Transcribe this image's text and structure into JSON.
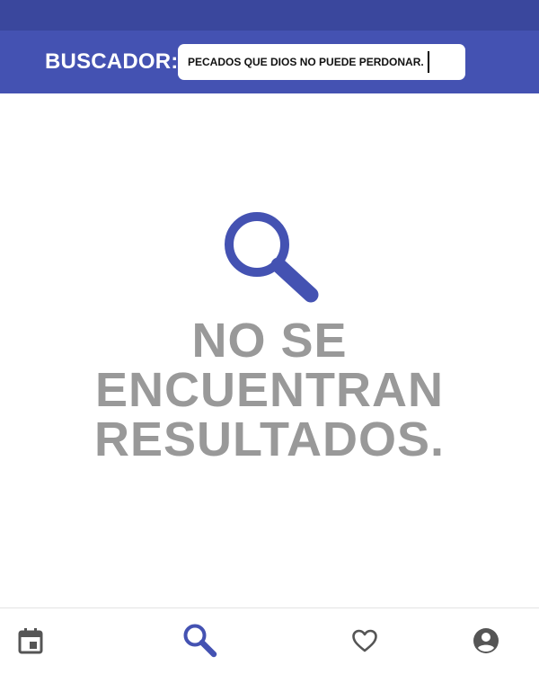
{
  "header": {
    "label": "BUSCADOR:",
    "search_value": "PECADOS QUE DIOS NO PUEDE PERDONAR."
  },
  "empty_state": {
    "icon": "search-icon",
    "message_line_1": "NO SE",
    "message_line_2": "ENCUENTRAN",
    "message_line_3": "RESULTADOS."
  },
  "tab_bar": {
    "items": [
      {
        "icon": "calendar-icon",
        "active": false
      },
      {
        "icon": "search-icon",
        "active": true
      },
      {
        "icon": "heart-icon",
        "active": false
      },
      {
        "icon": "account-icon",
        "active": false
      }
    ]
  },
  "colors": {
    "status_bar": "#3a479d",
    "header": "#4452b2",
    "accent": "#4452b2",
    "empty_text": "#999999",
    "inactive_icon": "#555555"
  }
}
